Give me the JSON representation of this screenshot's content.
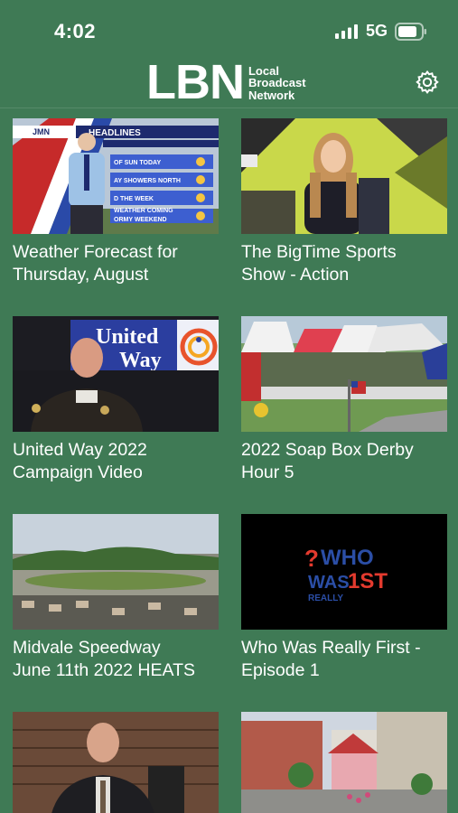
{
  "status_bar": {
    "time": "4:02",
    "network": "5G"
  },
  "header": {
    "logo_main": "LBN",
    "logo_sub": [
      "Local",
      "Broadcast",
      "Network"
    ],
    "settings_icon": "gear-icon"
  },
  "colors": {
    "background": "#3f7a55",
    "text": "#ffffff"
  },
  "videos": [
    {
      "title": "Weather Forecast for\nThursday, August",
      "thumb_text": [
        "HEADLINES",
        "OF SUN TODAY",
        "AY SHOWERS NORTH",
        "D THE WEEK",
        "WEATHER COMING",
        "ORMY WEEKEND"
      ]
    },
    {
      "title": "The BigTime Sports\nShow - Action"
    },
    {
      "title": "United Way 2022\nCampaign Video",
      "thumb_text": [
        "United",
        "Way"
      ]
    },
    {
      "title": "2022 Soap Box Derby\nHour 5"
    },
    {
      "title": "Midvale Speedway\nJune 11th 2022 HEATS"
    },
    {
      "title": "Who Was Really First -\nEpisode 1",
      "thumb_text": [
        "WHO",
        "WAS",
        "1ST",
        "REALLY"
      ]
    },
    {
      "title": ""
    },
    {
      "title": ""
    }
  ]
}
